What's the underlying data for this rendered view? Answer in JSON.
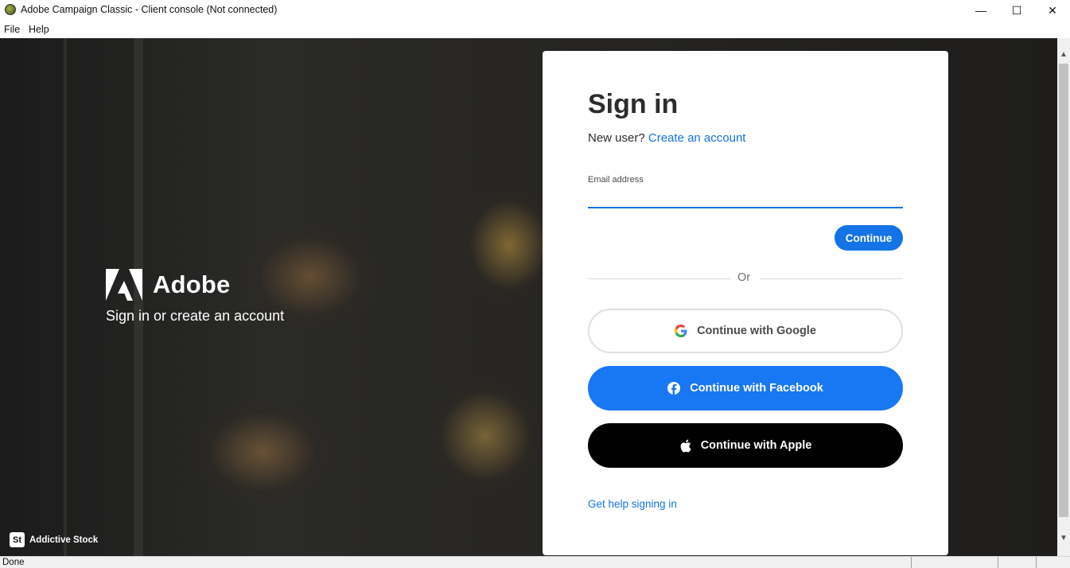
{
  "window": {
    "title": "Adobe Campaign Classic - Client console (Not connected)",
    "minimize_glyph": "—",
    "maximize_glyph": "☐",
    "close_glyph": "✕"
  },
  "menu": {
    "file": "File",
    "help": "Help"
  },
  "hero": {
    "brand_name": "Adobe",
    "tagline": "Sign in or create an account",
    "credit_icon": "St",
    "credit_label": "Addictive Stock"
  },
  "signin": {
    "title": "Sign in",
    "new_user_text": "New user?",
    "create_account_link": "Create an account",
    "email_label": "Email address",
    "email_value": "",
    "continue_label": "Continue",
    "or_text": "Or",
    "google_label": "Continue with Google",
    "facebook_label": "Continue with Facebook",
    "apple_label": "Continue with Apple",
    "help_link": "Get help signing in"
  },
  "status": {
    "text": "Done"
  },
  "colors": {
    "accent_blue": "#1473e6",
    "facebook_blue": "#1877f2",
    "apple_black": "#000000"
  }
}
